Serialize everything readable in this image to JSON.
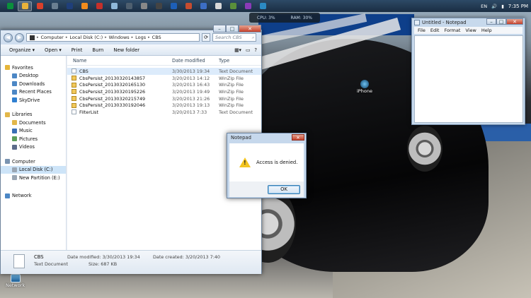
{
  "taskbar": {
    "apps": [
      {
        "name": "flag-icon",
        "color": "#0a8f3c"
      },
      {
        "name": "explorer-icon",
        "color": "#e8b33b",
        "active": true
      },
      {
        "name": "chrome-icon",
        "color": "#d9402b"
      },
      {
        "name": "app-icon",
        "color": "#6a7f91"
      },
      {
        "name": "photoshop-icon",
        "color": "#1f3f7a"
      },
      {
        "name": "illustrator-icon",
        "color": "#f08c1d"
      },
      {
        "name": "adobe-icon",
        "color": "#c4302b"
      },
      {
        "name": "notepad-icon",
        "color": "#8fb8d9"
      },
      {
        "name": "media-icon",
        "color": "#4e5f6f"
      },
      {
        "name": "game-icon",
        "color": "#888"
      },
      {
        "name": "app-icon-2",
        "color": "#444"
      },
      {
        "name": "outlook-icon",
        "color": "#1d5fb8"
      },
      {
        "name": "app-icon-3",
        "color": "#c64c2f"
      },
      {
        "name": "app-icon-4",
        "color": "#3c6ec4"
      },
      {
        "name": "app-icon-5",
        "color": "#d8d8d8"
      },
      {
        "name": "app-icon-6",
        "color": "#5a8f3a"
      },
      {
        "name": "app-icon-7",
        "color": "#8a3ab8"
      },
      {
        "name": "app-icon-8",
        "color": "#2b8ac4"
      }
    ],
    "language": "EN",
    "clock": "7:35 PM"
  },
  "gadget": {
    "cpu": "CPU: 3%",
    "ram": "RAM: 30%"
  },
  "explorer": {
    "breadcrumb": [
      "Computer",
      "Local Disk (C:)",
      "Windows",
      "Logs",
      "CBS"
    ],
    "search_placeholder": "Search CBS",
    "toolbar": {
      "organize": "Organize ▾",
      "open": "Open ▾",
      "print": "Print",
      "burn": "Burn",
      "new_folder": "New folder"
    },
    "nav": [
      {
        "label": "Favorites",
        "top": true,
        "icon": "star-icon",
        "color": "#e5b53a"
      },
      {
        "label": "Desktop",
        "icon": "desktop-icon",
        "color": "#4c87c5"
      },
      {
        "label": "Downloads",
        "icon": "downloads-icon",
        "color": "#4c87c5"
      },
      {
        "label": "Recent Places",
        "icon": "recent-places-icon",
        "color": "#4c87c5"
      },
      {
        "label": "SkyDrive",
        "icon": "skydrive-icon",
        "color": "#2f7fd0"
      },
      {
        "label": "Libraries",
        "top": true,
        "icon": "libraries-icon",
        "color": "#e2b74a"
      },
      {
        "label": "Documents",
        "icon": "documents-icon",
        "color": "#e2b74a"
      },
      {
        "label": "Music",
        "icon": "music-icon",
        "color": "#3a6fb5"
      },
      {
        "label": "Pictures",
        "icon": "pictures-icon",
        "color": "#5c9e5a"
      },
      {
        "label": "Videos",
        "icon": "videos-icon",
        "color": "#5c6c8a"
      },
      {
        "label": "Computer",
        "top": true,
        "icon": "computer-icon",
        "color": "#7a94b1"
      },
      {
        "label": "Local Disk (C:)",
        "icon": "disk-icon",
        "color": "#9aa6b3",
        "selected": true
      },
      {
        "label": "New Partition (E:)",
        "icon": "disk-icon",
        "color": "#9aa6b3"
      },
      {
        "label": "Network",
        "top": true,
        "icon": "network-icon",
        "color": "#4c87c5"
      }
    ],
    "columns": {
      "name": "Name",
      "date": "Date modified",
      "type": "Type"
    },
    "files": [
      {
        "name": "CBS",
        "date": "3/30/2013 19:34",
        "type": "Text Document",
        "zip": false,
        "selected": true
      },
      {
        "name": "CbsPersist_20130320143857",
        "date": "3/20/2013 14:12",
        "type": "WinZip File",
        "zip": true
      },
      {
        "name": "CbsPersist_20130320165130",
        "date": "3/20/2013 16:43",
        "type": "WinZip File",
        "zip": true
      },
      {
        "name": "CbsPersist_20130320195226",
        "date": "3/20/2013 19:49",
        "type": "WinZip File",
        "zip": true
      },
      {
        "name": "CbsPersist_20130320215749",
        "date": "3/20/2013 21:26",
        "type": "WinZip File",
        "zip": true
      },
      {
        "name": "CbsPersist_20130330192046",
        "date": "3/20/2013 19:13",
        "type": "WinZip File",
        "zip": true
      },
      {
        "name": "FilterList",
        "date": "3/20/2013 7:33",
        "type": "Text Document",
        "zip": false
      }
    ],
    "details": {
      "name": "CBS",
      "type": "Text Document",
      "modified": "Date modified: 3/30/2013 19:34",
      "created": "Date created: 3/20/2013 7:40",
      "size": "Size: 687 KB"
    }
  },
  "notepad": {
    "title": "Untitled - Notepad",
    "menu": [
      "File",
      "Edit",
      "Format",
      "View",
      "Help"
    ]
  },
  "dialog": {
    "title": "Notepad",
    "message": "Access is denied.",
    "ok": "OK"
  },
  "desktop": {
    "network_label": "Network",
    "iphone_label": "iPhone"
  }
}
